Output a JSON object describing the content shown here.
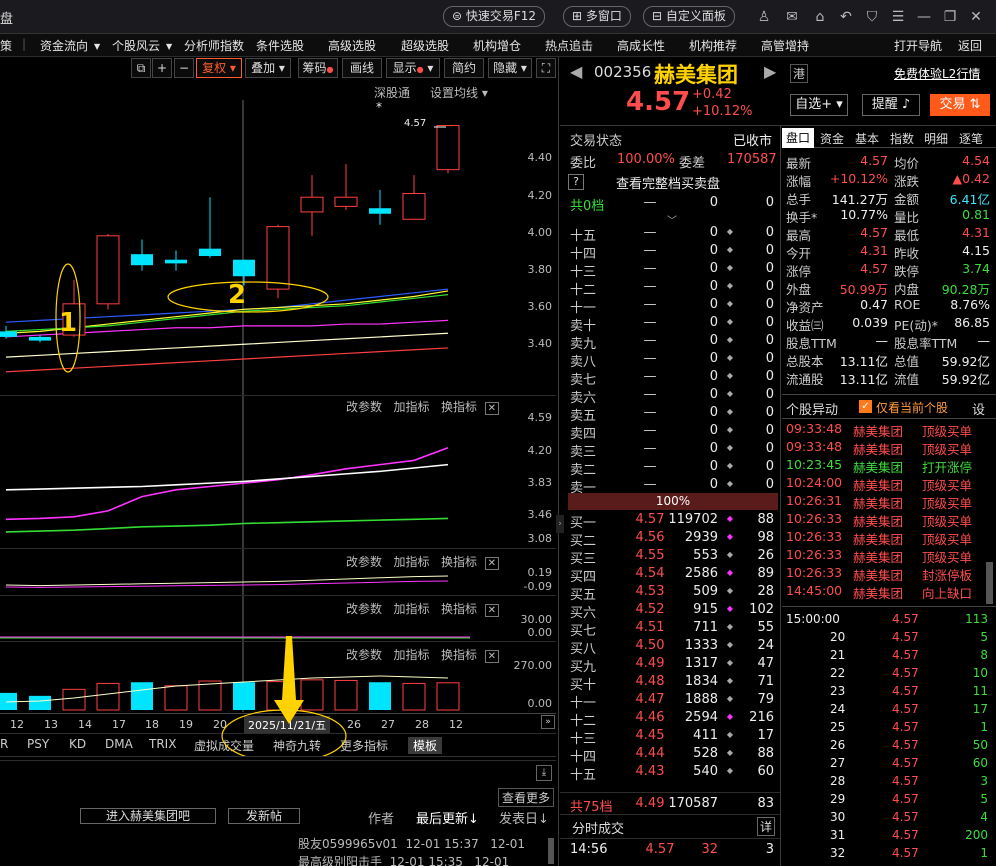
{
  "app_title": "盘",
  "titlebar": {
    "quick_trade": "快速交易F12",
    "multi_window": "多窗口",
    "custom_panel": "自定义面板"
  },
  "menu": [
    "策",
    "资金流向",
    "个股风云",
    "分析师指数",
    "条件选股",
    "高级选股",
    "超级选股",
    "机构增仓",
    "热点追击",
    "高成长性",
    "机构推荐",
    "高管增持",
    "打开导航",
    "返回"
  ],
  "toolbar": {
    "fuquan": "复权",
    "overlay": "叠加",
    "chip": "筹码",
    "draw_line": "画线",
    "display": "显示",
    "simple": "简约",
    "hide": "隐藏"
  },
  "chart_header": {
    "shentong": "深股通",
    "set_ma": "设置均线"
  },
  "stock": {
    "code": "002356",
    "name": "赫美集团",
    "hk_badge": "港",
    "free_l2": "免费体验L2行情",
    "price": "4.57",
    "change": "+0.42",
    "change_pct": "+10.12%",
    "watchlist_btn": "自选+",
    "remind_btn": "提醒",
    "trade_btn": "交易"
  },
  "order_book": {
    "status_label": "交易状态",
    "status_value": "已收市",
    "weibi_label": "委比",
    "weibi_value": "100.00%",
    "weicha_label": "委差",
    "weicha_value": "170587",
    "full_book_q": "?",
    "full_book": "查看完整档买卖盘",
    "total_sell_label": "共0档",
    "total_sell_price": "—",
    "total_sell_vol": "0",
    "total_sell_cnt": "0",
    "sells": [
      {
        "label": "十五",
        "price": "—",
        "vol": "0",
        "cnt": "0"
      },
      {
        "label": "十四",
        "price": "—",
        "vol": "0",
        "cnt": "0"
      },
      {
        "label": "十三",
        "price": "—",
        "vol": "0",
        "cnt": "0"
      },
      {
        "label": "十二",
        "price": "—",
        "vol": "0",
        "cnt": "0"
      },
      {
        "label": "十一",
        "price": "—",
        "vol": "0",
        "cnt": "0"
      },
      {
        "label": "卖十",
        "price": "—",
        "vol": "0",
        "cnt": "0"
      },
      {
        "label": "卖九",
        "price": "—",
        "vol": "0",
        "cnt": "0"
      },
      {
        "label": "卖八",
        "price": "—",
        "vol": "0",
        "cnt": "0"
      },
      {
        "label": "卖七",
        "price": "—",
        "vol": "0",
        "cnt": "0"
      },
      {
        "label": "卖六",
        "price": "—",
        "vol": "0",
        "cnt": "0"
      },
      {
        "label": "卖五",
        "price": "—",
        "vol": "0",
        "cnt": "0"
      },
      {
        "label": "卖四",
        "price": "—",
        "vol": "0",
        "cnt": "0"
      },
      {
        "label": "卖三",
        "price": "—",
        "vol": "0",
        "cnt": "0"
      },
      {
        "label": "卖二",
        "price": "—",
        "vol": "0",
        "cnt": "0"
      },
      {
        "label": "卖一",
        "price": "—",
        "vol": "0",
        "cnt": "0"
      }
    ],
    "pct_bar": "100%",
    "buys": [
      {
        "label": "买一",
        "price": "4.57",
        "vol": "119702",
        "cnt": "88",
        "mark": true
      },
      {
        "label": "买二",
        "price": "4.56",
        "vol": "2939",
        "cnt": "98",
        "mark": true
      },
      {
        "label": "买三",
        "price": "4.55",
        "vol": "553",
        "cnt": "26",
        "mark": false
      },
      {
        "label": "买四",
        "price": "4.54",
        "vol": "2586",
        "cnt": "89",
        "mark": true
      },
      {
        "label": "买五",
        "price": "4.53",
        "vol": "509",
        "cnt": "28",
        "mark": false
      },
      {
        "label": "买六",
        "price": "4.52",
        "vol": "915",
        "cnt": "102",
        "mark": true
      },
      {
        "label": "买七",
        "price": "4.51",
        "vol": "711",
        "cnt": "55",
        "mark": false
      },
      {
        "label": "买八",
        "price": "4.50",
        "vol": "1333",
        "cnt": "24",
        "mark": false
      },
      {
        "label": "买九",
        "price": "4.49",
        "vol": "1317",
        "cnt": "47",
        "mark": false
      },
      {
        "label": "买十",
        "price": "4.48",
        "vol": "1834",
        "cnt": "71",
        "mark": false
      },
      {
        "label": "十一",
        "price": "4.47",
        "vol": "1888",
        "cnt": "79",
        "mark": false
      },
      {
        "label": "十二",
        "price": "4.46",
        "vol": "2594",
        "cnt": "216",
        "mark": true
      },
      {
        "label": "十三",
        "price": "4.45",
        "vol": "411",
        "cnt": "17",
        "mark": false
      },
      {
        "label": "十四",
        "price": "4.44",
        "vol": "528",
        "cnt": "88",
        "mark": false
      },
      {
        "label": "十五",
        "price": "4.43",
        "vol": "540",
        "cnt": "60",
        "mark": false
      }
    ],
    "total_buy_label": "共75档",
    "total_buy_price": "4.49",
    "total_buy_vol": "170587",
    "total_buy_cnt": "83",
    "tick_title": "分时成交",
    "tick_detail": "详",
    "tick_last": {
      "time": "14:56",
      "price": "4.57",
      "vol": "32",
      "cnt": "3"
    }
  },
  "right_tabs": [
    "盘口",
    "资金",
    "基本",
    "指数",
    "明细",
    "逐笔"
  ],
  "quote": {
    "latest_l": "最新",
    "latest_v": "4.57",
    "avg_l": "均价",
    "avg_v": "4.54",
    "chgpct_l": "涨幅",
    "chgpct_v": "+10.12%",
    "chg_l": "涨跌",
    "chg_v": "▲0.42",
    "vol_l": "总手",
    "vol_v": "141.27万",
    "amt_l": "金额",
    "amt_v": "6.41亿",
    "turn_l": "换手*",
    "turn_v": "10.77%",
    "vr_l": "量比",
    "vr_v": "0.81",
    "high_l": "最高",
    "high_v": "4.57",
    "low_l": "最低",
    "low_v": "4.31",
    "open_l": "今开",
    "open_v": "4.31",
    "prev_l": "昨收",
    "prev_v": "4.15",
    "up_l": "涨停",
    "up_v": "4.57",
    "dn_l": "跌停",
    "dn_v": "3.74",
    "outer_l": "外盘",
    "outer_v": "50.99万",
    "inner_l": "内盘",
    "inner_v": "90.28万",
    "nav_l": "净资产",
    "nav_v": "0.47",
    "roe_l": "ROE",
    "roe_v": "8.76%",
    "eps_l": "收益㈢",
    "eps_v": "0.039",
    "pe_l": "PE(动)*",
    "pe_v": "86.85",
    "div_l": "股息TTM",
    "div_v": "—",
    "divr_l": "股息率TTM",
    "divr_v": "—",
    "shares_l": "总股本",
    "shares_v": "13.11亿",
    "mcap_l": "总值",
    "mcap_v": "59.92亿",
    "float_l": "流通股",
    "float_v": "13.11亿",
    "fmcap_l": "流值",
    "fmcap_v": "59.92亿"
  },
  "events": {
    "title": "个股异动",
    "only_current": "仅看当前个股",
    "settings": "设",
    "rows": [
      {
        "time": "09:33:48",
        "name": "赫美集团",
        "type": "顶级买单",
        "color": "red"
      },
      {
        "time": "09:33:48",
        "name": "赫美集团",
        "type": "顶级买单",
        "color": "red"
      },
      {
        "time": "10:23:45",
        "name": "赫美集团",
        "type": "打开涨停",
        "color": "green"
      },
      {
        "time": "10:24:00",
        "name": "赫美集团",
        "type": "顶级买单",
        "color": "red"
      },
      {
        "time": "10:26:31",
        "name": "赫美集团",
        "type": "顶级买单",
        "color": "red"
      },
      {
        "time": "10:26:33",
        "name": "赫美集团",
        "type": "顶级买单",
        "color": "red"
      },
      {
        "time": "10:26:33",
        "name": "赫美集团",
        "type": "顶级买单",
        "color": "red"
      },
      {
        "time": "10:26:33",
        "name": "赫美集团",
        "type": "顶级买单",
        "color": "red"
      },
      {
        "time": "10:26:33",
        "name": "赫美集团",
        "type": "封涨停板",
        "color": "red"
      },
      {
        "time": "14:45:00",
        "name": "赫美集团",
        "type": "向上缺口",
        "color": "red"
      }
    ]
  },
  "ticks": [
    {
      "t": "15:00:00",
      "p": "4.57",
      "v": "113"
    },
    {
      "t": "20",
      "p": "4.57",
      "v": "5"
    },
    {
      "t": "21",
      "p": "4.57",
      "v": "8"
    },
    {
      "t": "22",
      "p": "4.57",
      "v": "10"
    },
    {
      "t": "23",
      "p": "4.57",
      "v": "11"
    },
    {
      "t": "24",
      "p": "4.57",
      "v": "17"
    },
    {
      "t": "25",
      "p": "4.57",
      "v": "1"
    },
    {
      "t": "26",
      "p": "4.57",
      "v": "50"
    },
    {
      "t": "27",
      "p": "4.57",
      "v": "60"
    },
    {
      "t": "28",
      "p": "4.57",
      "v": "3"
    },
    {
      "t": "29",
      "p": "4.57",
      "v": "5"
    },
    {
      "t": "30",
      "p": "4.57",
      "v": "4"
    },
    {
      "t": "31",
      "p": "4.57",
      "v": "200"
    },
    {
      "t": "32",
      "p": "4.57",
      "v": "1"
    }
  ],
  "indicators": {
    "change_param": "改参数",
    "add_indicator": "加指标",
    "switch_indicator": "换指标"
  },
  "axes": {
    "main": [
      "4.40",
      "4.20",
      "4.00",
      "3.80",
      "3.60",
      "3.40"
    ],
    "ind1": [
      "4.59",
      "4.20",
      "3.83",
      "3.46",
      "3.08"
    ],
    "ind2": [
      "0.19",
      "-0.09"
    ],
    "ind3": [
      "30.00",
      "0.00"
    ],
    "ind4": [
      "270.00",
      "0.00"
    ]
  },
  "annotations": {
    "circle1": "1",
    "circle2": "2",
    "price_tag": "4.57",
    "star": "*"
  },
  "dates": [
    "12",
    "13",
    "14",
    "17",
    "18",
    "19",
    "20",
    "2025/11/21/五",
    "26",
    "27",
    "28",
    "12"
  ],
  "bottom_tabs": [
    "R",
    "PSY",
    "KD",
    "DMA",
    "TRIX",
    "虚拟成交量",
    "神奇九转",
    "更多指标",
    "模板"
  ],
  "forum": {
    "enter_btn": "进入赫美集团吧",
    "post_btn": "发新帖",
    "author_col": "作者",
    "latest_col": "最后更新",
    "post_col": "发表日",
    "more": "查看更多",
    "rows": [
      {
        "author": "股友0599965v01",
        "update": "12-01 15:37",
        "date": "12-01"
      },
      {
        "author": "最高级别阳击手",
        "update": "12-01 15:35",
        "date": "12-01"
      }
    ]
  },
  "chart_data": {
    "type": "candlestick",
    "candles": [
      {
        "o": 3.42,
        "c": 3.45,
        "h": 3.48,
        "l": 3.41,
        "color": "cyan"
      },
      {
        "o": 3.42,
        "c": 3.4,
        "h": 3.43,
        "l": 3.39,
        "color": "cyan"
      },
      {
        "o": 3.43,
        "c": 3.6,
        "h": 3.73,
        "l": 3.42,
        "color": "red"
      },
      {
        "o": 3.6,
        "c": 3.97,
        "h": 3.98,
        "l": 3.57,
        "color": "red"
      },
      {
        "o": 3.87,
        "c": 3.81,
        "h": 3.95,
        "l": 3.78,
        "color": "cyan"
      },
      {
        "o": 3.84,
        "c": 3.82,
        "h": 3.89,
        "l": 3.78,
        "color": "cyan"
      },
      {
        "o": 3.9,
        "c": 3.86,
        "h": 4.18,
        "l": 3.85,
        "color": "cyan"
      },
      {
        "o": 3.84,
        "c": 3.75,
        "h": 3.84,
        "l": 3.7,
        "color": "cyan"
      },
      {
        "o": 3.68,
        "c": 4.02,
        "h": 4.03,
        "l": 3.63,
        "color": "red"
      },
      {
        "o": 4.1,
        "c": 4.18,
        "h": 4.3,
        "l": 3.97,
        "color": "red"
      },
      {
        "o": 4.13,
        "c": 4.18,
        "h": 4.36,
        "l": 4.11,
        "color": "red"
      },
      {
        "o": 4.12,
        "c": 4.09,
        "h": 4.22,
        "l": 4.03,
        "color": "cyan"
      },
      {
        "o": 4.06,
        "c": 4.2,
        "h": 4.3,
        "l": 4.06,
        "color": "red"
      },
      {
        "o": 4.33,
        "c": 4.57,
        "h": 4.57,
        "l": 4.31,
        "color": "red"
      }
    ],
    "ylim": [
      3.24,
      4.6
    ],
    "ma_lines": [
      {
        "color": "#2e5bff",
        "values": [
          3.5,
          3.51,
          3.52,
          3.53,
          3.54,
          3.55,
          3.56,
          3.57,
          3.58,
          3.6,
          3.62,
          3.64,
          3.66,
          3.68
        ]
      },
      {
        "color": "#ffff33",
        "values": [
          3.44,
          3.45,
          3.47,
          3.49,
          3.51,
          3.53,
          3.55,
          3.57,
          3.58,
          3.59,
          3.6,
          3.62,
          3.64,
          3.67
        ]
      },
      {
        "color": "#33dd33",
        "values": [
          3.45,
          3.46,
          3.47,
          3.48,
          3.5,
          3.52,
          3.54,
          3.56,
          3.57,
          3.58,
          3.59,
          3.61,
          3.63,
          3.65
        ]
      },
      {
        "color": "#ff33ff",
        "values": [
          3.42,
          3.43,
          3.44,
          3.45,
          3.46,
          3.47,
          3.47,
          3.48,
          3.48,
          3.48,
          3.49,
          3.49,
          3.5,
          3.51
        ]
      },
      {
        "color": "#ffffcc",
        "values": [
          3.31,
          3.32,
          3.33,
          3.34,
          3.35,
          3.36,
          3.37,
          3.38,
          3.39,
          3.4,
          3.41,
          3.42,
          3.43,
          3.44
        ]
      },
      {
        "color": "#ff4040",
        "values": [
          3.23,
          3.24,
          3.25,
          3.26,
          3.27,
          3.28,
          3.29,
          3.3,
          3.31,
          3.32,
          3.33,
          3.34,
          3.35,
          3.36
        ]
      }
    ],
    "volume": [
      60,
      35,
      90,
      140,
      150,
      120,
      160,
      150,
      155,
      170,
      165,
      150,
      140,
      145
    ],
    "volume_colors": [
      "cyan",
      "cyan",
      "red",
      "red",
      "cyan",
      "red",
      "red",
      "cyan",
      "red",
      "red",
      "red",
      "cyan",
      "red",
      "red"
    ]
  }
}
